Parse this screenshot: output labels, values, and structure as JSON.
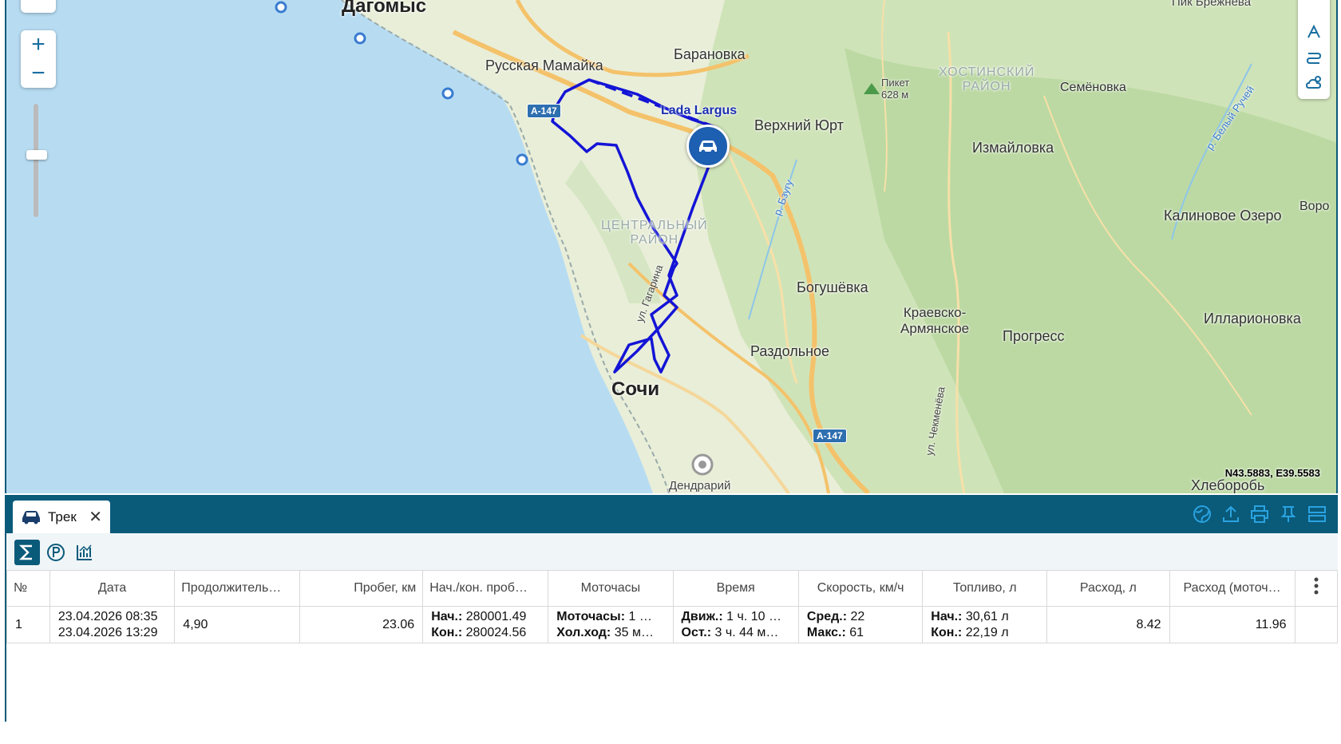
{
  "map": {
    "places": {
      "dagomys": "Дагомыс",
      "russkaya_mamaika": "Русская Мамайка",
      "baranovka": "Барановка",
      "verkhniy_yurt": "Верхний Юрт",
      "izmailovka": "Измайловка",
      "semenovka": "Семёновка",
      "khostinskiy": "ХОСТИНСКИЙ\nРАЙОН",
      "piket": "Пикет\n628 м",
      "pik_brezhneva": "Пик Брежнева",
      "kalinovoe": "Калиновое Озеро",
      "voro": "Воро",
      "tsentralny": "ЦЕНТРАЛЬНЫЙ\nРАЙОН",
      "bogushevka": "Богушёвка",
      "kraevsko": "Краевско-\nАрмянское",
      "progress": "Прогресс",
      "illarionovka": "Илларионовка",
      "razdolnoe": "Раздольное",
      "sochi": "Сочи",
      "dendrariy": "Дендрарий",
      "khlebororob": "Хлеборобь",
      "gagarina": "ул. Гагарина",
      "bzugu": "р. Бзугу",
      "chekmeneva": "ул. Чекменёва",
      "bely_ruchei": "р. Белый Ручей"
    },
    "road_badges": [
      "A-147",
      "A-147"
    ],
    "vehicle_name": "Lada Largus",
    "coordinates": "N43.5883, E39.5583",
    "colors": {
      "track": "#1414d6",
      "water": "#b7dcf2",
      "panel": "#0a5a7a"
    }
  },
  "panel": {
    "tab_label": "Трек",
    "tab_icon": "car-icon",
    "close_glyph": "✕",
    "header_tools": [
      "globe-icon",
      "upload-icon",
      "print-icon",
      "pin-icon",
      "layout-icon"
    ],
    "toolbar": [
      "sum-icon",
      "parking-icon",
      "chart-icon"
    ]
  },
  "table": {
    "columns": [
      "№",
      "Дата",
      "Продолжитель…",
      "Пробег, км",
      "Нач./кон. проб…",
      "Моточасы",
      "Время",
      "Скорость, км/ч",
      "Топливо, л",
      "Расход, л",
      "Расход (моточ…"
    ],
    "row": {
      "num": "1",
      "date_start": "23.04.2026 08:35",
      "date_end": "23.04.2026 13:29",
      "duration": "4,90",
      "mileage": "23.06",
      "mil_start_label": "Нач.:",
      "mil_start": "280001.49",
      "mil_end_label": "Кон.:",
      "mil_end": "280024.56",
      "moto_label": "Моточасы:",
      "moto_val": "1 …",
      "idle_label": "Хол.ход:",
      "idle_val": "35 м…",
      "move_label": "Движ.:",
      "move_val": "1 ч. 10 …",
      "stop_label": "Ост.:",
      "stop_val": "3 ч. 44 м…",
      "avg_label": "Сред.:",
      "avg_val": "22",
      "max_label": "Макс.:",
      "max_val": "61",
      "fuel_start_label": "Нач.:",
      "fuel_start": "30,61 л",
      "fuel_end_label": "Кон.:",
      "fuel_end": "22,19 л",
      "consumption": "8.42",
      "consumption_moto": "11.96"
    }
  }
}
